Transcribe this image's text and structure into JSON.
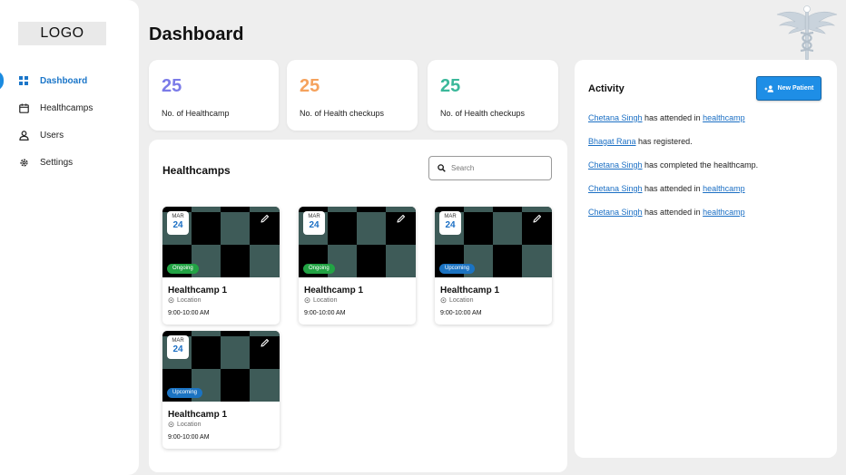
{
  "sidebar": {
    "logo": "LOGO",
    "items": [
      {
        "label": "Dashboard",
        "icon": "grid-icon",
        "active": true
      },
      {
        "label": "Healthcamps",
        "icon": "calendar-icon",
        "active": false
      },
      {
        "label": "Users",
        "icon": "user-icon",
        "active": false
      },
      {
        "label": "Settings",
        "icon": "gear-icon",
        "active": false
      }
    ]
  },
  "header": {
    "title": "Dashboard",
    "emblem": "caduceus-icon"
  },
  "stats": [
    {
      "value": "25",
      "label": "No. of Healthcamp",
      "color": "#7b7be8"
    },
    {
      "value": "25",
      "label": "No. of Health checkups",
      "color": "#f5a25d"
    },
    {
      "value": "25",
      "label": "No. of Health checkups",
      "color": "#3bb89a"
    }
  ],
  "healthcamps": {
    "title": "Healthcamps",
    "search_placeholder": "Search",
    "cards": [
      {
        "month": "MAR",
        "day": "24",
        "status": "Ongoing",
        "name": "Healthcamp 1",
        "location": "Location",
        "time": "9:00-10:00 AM"
      },
      {
        "month": "MAR",
        "day": "24",
        "status": "Ongoing",
        "name": "Healthcamp 1",
        "location": "Location",
        "time": "9:00-10:00 AM"
      },
      {
        "month": "MAR",
        "day": "24",
        "status": "Upcoming",
        "name": "Healthcamp 1",
        "location": "Location",
        "time": "9:00-10:00 AM"
      },
      {
        "month": "MAR",
        "day": "24",
        "status": "Upcoming",
        "name": "Healthcamp 1",
        "location": "Location",
        "time": "9:00-10:00 AM"
      }
    ]
  },
  "activity": {
    "title": "Activity",
    "new_patient_label": "New Patient",
    "items": [
      {
        "person": "Chetana Singh",
        "text": " has attended in ",
        "link": "healthcamp",
        "tail": ""
      },
      {
        "person": "Bhagat Rana",
        "text": " has registered.",
        "link": "",
        "tail": ""
      },
      {
        "person": "Chetana Singh",
        "text": " has completed the healthcamp.",
        "link": "",
        "tail": ""
      },
      {
        "person": "Chetana Singh",
        "text": " has attended in ",
        "link": "healthcamp",
        "tail": ""
      },
      {
        "person": "Chetana Singh",
        "text": " has attended in ",
        "link": "healthcamp",
        "tail": ""
      }
    ]
  },
  "colors": {
    "accent": "#1b76c9",
    "ongoing": "#22a344",
    "upcoming": "#1b73c2",
    "tile_dark": "#3e5b58"
  }
}
